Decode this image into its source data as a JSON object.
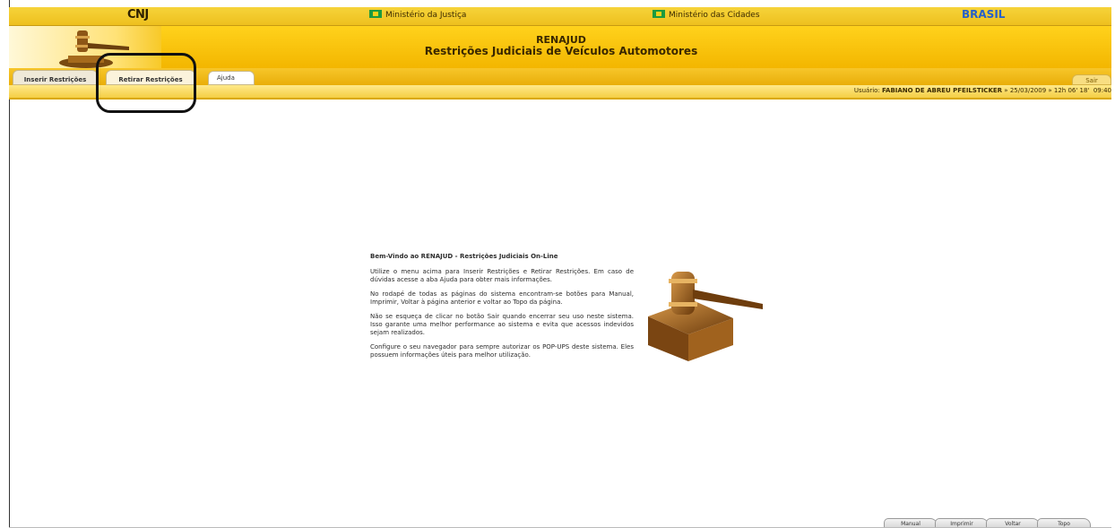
{
  "logo_bar": {
    "cnj": "CNJ",
    "ministerio_justica": "Ministério da Justiça",
    "ministerio_cidades": "Ministério das Cidades",
    "brasil": "BRASIL"
  },
  "header": {
    "title": "RENAJUD",
    "subtitle": "Restrições Judiciais de Veículos Automotores"
  },
  "tabs": [
    {
      "label": "Inserir Restrições"
    },
    {
      "label": "Retirar Restrições"
    },
    {
      "label": "Ajuda"
    }
  ],
  "sair_label": "Sair",
  "user_bar": {
    "prefix": "Usuário:",
    "user": "FABIANO DE ABREU PFEILSTICKER",
    "sep": "»",
    "datetime": "25/03/2009 » 12h 06' 18'",
    "time": "09:40"
  },
  "welcome": {
    "heading": "Bem-Vindo ao RENAJUD - Restrições Judiciais On-Line",
    "p1": "Utilize o menu acima para Inserir Restrições e Retirar Restrições. Em caso de dúvidas acesse a aba Ajuda para obter mais informações.",
    "p2": "No rodapé de todas as páginas do sistema encontram-se botões para Manual, Imprimir, Voltar à página anterior e voltar ao Topo da página.",
    "p3": "Não se esqueça de clicar no botão Sair quando encerrar seu uso neste sistema. Isso garante uma melhor performance ao sistema e evita que acessos indevidos sejam realizados.",
    "p4": "Configure o seu navegador para sempre autorizar os POP-UPS deste sistema. Eles possuem informações úteis para melhor utilização."
  },
  "footer": {
    "manual": "Manual",
    "imprimir": "Imprimir",
    "voltar": "Voltar",
    "topo": "Topo"
  }
}
